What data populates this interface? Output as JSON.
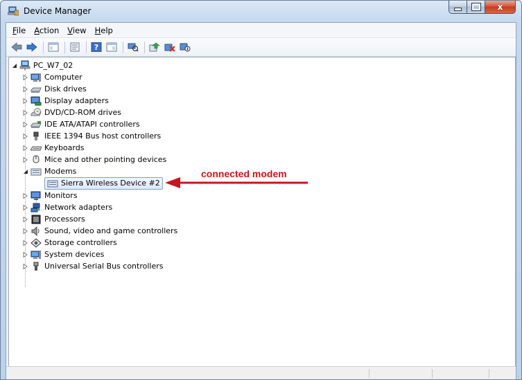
{
  "window": {
    "title": "Device Manager",
    "controls": {
      "minimize": "–",
      "maximize": "□",
      "close": "x"
    }
  },
  "menu": [
    {
      "label": "File",
      "key": "F",
      "rest": "ile"
    },
    {
      "label": "Action",
      "key": "A",
      "rest": "ction"
    },
    {
      "label": "View",
      "key": "V",
      "rest": "iew"
    },
    {
      "label": "Help",
      "key": "H",
      "rest": "elp"
    }
  ],
  "toolbar": {
    "icons": [
      "back-arrow-icon",
      "forward-arrow-icon",
      "show-hide-console-tree-icon",
      "properties-icon",
      "help-icon",
      "view-icon",
      "scan-hardware-icon",
      "update-driver-icon",
      "uninstall-icon",
      "disable-icon"
    ]
  },
  "tree": {
    "root": {
      "label": "PC_W7_02",
      "icon": "computer-network-icon"
    },
    "categories": [
      {
        "label": "Computer",
        "icon": "computer-icon",
        "expanded": false
      },
      {
        "label": "Disk drives",
        "icon": "disk-drive-icon",
        "expanded": false
      },
      {
        "label": "Display adapters",
        "icon": "display-adapter-icon",
        "expanded": false
      },
      {
        "label": "DVD/CD-ROM drives",
        "icon": "dvd-drive-icon",
        "expanded": false
      },
      {
        "label": "IDE ATA/ATAPI controllers",
        "icon": "ide-controller-icon",
        "expanded": false
      },
      {
        "label": "IEEE 1394 Bus host controllers",
        "icon": "firewire-icon",
        "expanded": false
      },
      {
        "label": "Keyboards",
        "icon": "keyboard-icon",
        "expanded": false
      },
      {
        "label": "Mice and other pointing devices",
        "icon": "mouse-icon",
        "expanded": false
      },
      {
        "label": "Modems",
        "icon": "modem-icon",
        "expanded": true
      },
      {
        "label": "Monitors",
        "icon": "monitor-icon",
        "expanded": false
      },
      {
        "label": "Network adapters",
        "icon": "network-adapter-icon",
        "expanded": false
      },
      {
        "label": "Processors",
        "icon": "processor-icon",
        "expanded": false
      },
      {
        "label": "Sound, video and game controllers",
        "icon": "sound-icon",
        "expanded": false
      },
      {
        "label": "Storage controllers",
        "icon": "storage-controller-icon",
        "expanded": false
      },
      {
        "label": "System devices",
        "icon": "system-devices-icon",
        "expanded": false
      },
      {
        "label": "Universal Serial Bus controllers",
        "icon": "usb-icon",
        "expanded": false
      }
    ],
    "modem_child": {
      "label": "Sierra Wireless Device #2",
      "icon": "modem-icon",
      "selected": true
    }
  },
  "annotation": {
    "text": "connected modem",
    "color": "#c8141e"
  },
  "colors": {
    "titlebar": "#c5d8ee",
    "selection_border": "#7da2ce",
    "close_button": "#c33a1d"
  }
}
